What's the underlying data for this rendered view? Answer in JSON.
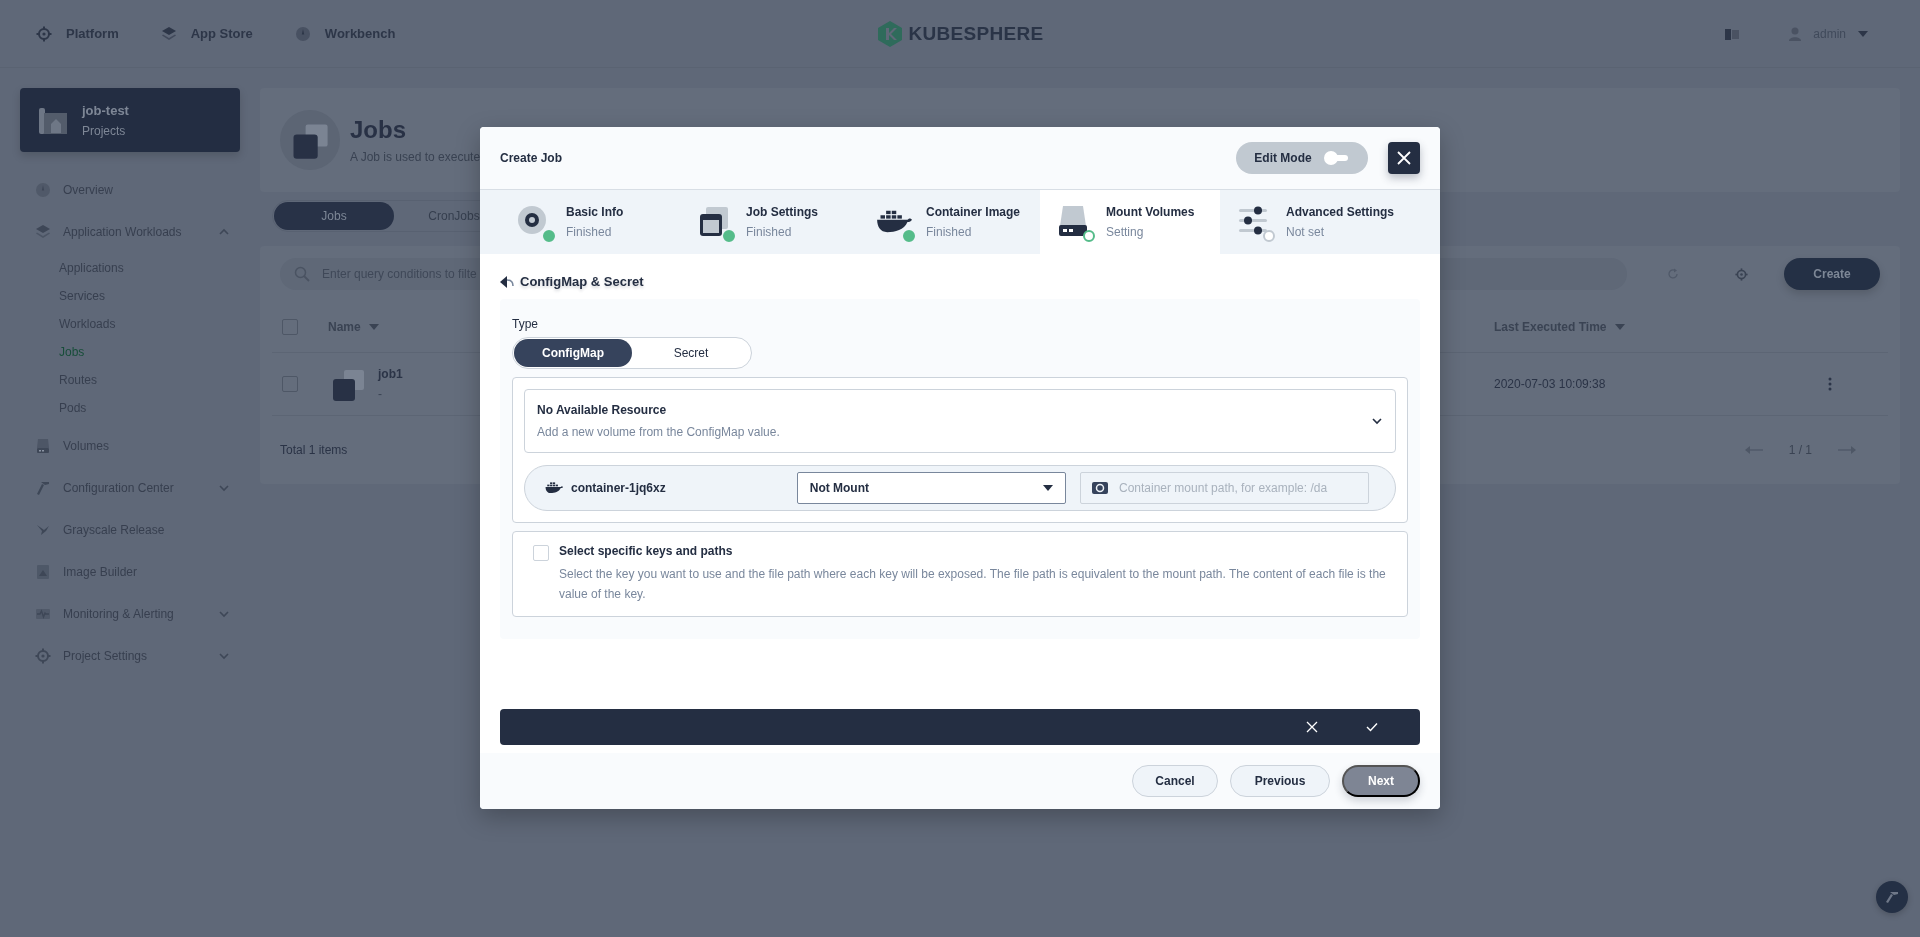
{
  "top_nav": {
    "items": [
      {
        "label": "Platform"
      },
      {
        "label": "App Store"
      },
      {
        "label": "Workbench"
      }
    ],
    "logo": "KUBESPHERE",
    "user": "admin"
  },
  "sidebar": {
    "project": {
      "name": "job-test",
      "type": "Projects"
    },
    "items": [
      {
        "label": "Overview"
      },
      {
        "label": "Application Workloads",
        "expanded": true,
        "children": [
          {
            "label": "Applications",
            "selected": false
          },
          {
            "label": "Services",
            "selected": false
          },
          {
            "label": "Workloads",
            "selected": false
          },
          {
            "label": "Jobs",
            "selected": true
          },
          {
            "label": "Routes",
            "selected": false
          },
          {
            "label": "Pods",
            "selected": false
          }
        ]
      },
      {
        "label": "Volumes"
      },
      {
        "label": "Configuration Center",
        "expanded": false
      },
      {
        "label": "Grayscale Release"
      },
      {
        "label": "Image Builder"
      },
      {
        "label": "Monitoring & Alerting",
        "expanded": false
      },
      {
        "label": "Project Settings",
        "expanded": false
      }
    ]
  },
  "page": {
    "title": "Jobs",
    "description": "A Job is used to execute",
    "tabs": [
      {
        "label": "Jobs",
        "selected": true
      },
      {
        "label": "CronJobs",
        "selected": false
      }
    ],
    "search": {
      "placeholder": "Enter query conditions to filte"
    },
    "create_button": "Create",
    "table": {
      "select_all": false,
      "columns": [
        "Name",
        "Last Executed Time"
      ],
      "rows": [
        {
          "checked": false,
          "name": "job1",
          "subtitle": "-",
          "last_executed": "2020-07-03 10:09:38"
        }
      ]
    },
    "total": "Total 1 items",
    "pagination": "1 / 1"
  },
  "modal": {
    "title": "Create Job",
    "edit_mode": {
      "label": "Edit Mode",
      "on": false
    },
    "steps": [
      {
        "title": "Basic Info",
        "status": "Finished",
        "finished": true,
        "selected": false
      },
      {
        "title": "Job Settings",
        "status": "Finished",
        "finished": true,
        "selected": false
      },
      {
        "title": "Container Image",
        "status": "Finished",
        "finished": true,
        "selected": false
      },
      {
        "title": "Mount Volumes",
        "status": "Setting",
        "finished": false,
        "selected": true
      },
      {
        "title": "Advanced Settings",
        "status": "Not set",
        "finished": false,
        "selected": false
      }
    ],
    "section_title": "ConfigMap & Secret",
    "type_label": "Type",
    "type_options": [
      {
        "label": "ConfigMap",
        "selected": true
      },
      {
        "label": "Secret",
        "selected": false
      }
    ],
    "resource": {
      "title": "No Available Resource",
      "description": "Add a new volume from the ConfigMap value."
    },
    "container": {
      "name": "container-1jq6xz",
      "mount": "Not Mount",
      "path_placeholder": "Container mount path, for example: /da"
    },
    "keys_option": {
      "checked": false,
      "title": "Select specific keys and paths",
      "description": "Select the key you want to use and the file path where each key will be exposed. The file path is equivalent to the mount path. The content of each file is the value of the key."
    },
    "buttons": [
      {
        "label": "Cancel",
        "kind": "secondary"
      },
      {
        "label": "Previous",
        "kind": "secondary"
      },
      {
        "label": "Next",
        "kind": "primary"
      }
    ]
  }
}
